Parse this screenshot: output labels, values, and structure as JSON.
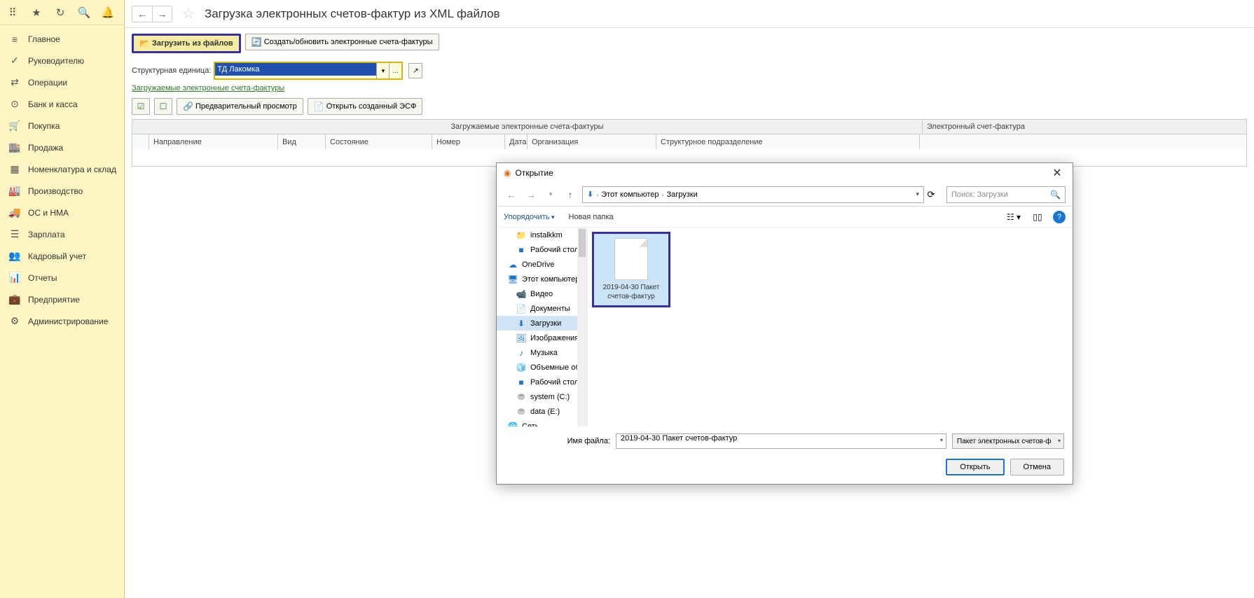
{
  "sidebar": {
    "items": [
      {
        "icon": "≡",
        "label": "Главное"
      },
      {
        "icon": "✓",
        "label": "Руководителю"
      },
      {
        "icon": "⇄",
        "label": "Операции"
      },
      {
        "icon": "⊙",
        "label": "Банк и касса"
      },
      {
        "icon": "🛒",
        "label": "Покупка"
      },
      {
        "icon": "🏬",
        "label": "Продажа"
      },
      {
        "icon": "▦",
        "label": "Номенклатура и склад"
      },
      {
        "icon": "🏭",
        "label": "Производство"
      },
      {
        "icon": "🚚",
        "label": "ОС и НМА"
      },
      {
        "icon": "☰",
        "label": "Зарплата"
      },
      {
        "icon": "👥",
        "label": "Кадровый учет"
      },
      {
        "icon": "📊",
        "label": "Отчеты"
      },
      {
        "icon": "💼",
        "label": "Предприятие"
      },
      {
        "icon": "⚙",
        "label": "Администрирование"
      }
    ]
  },
  "header": {
    "title": "Загрузка электронных счетов-фактур из XML файлов"
  },
  "toolbar": {
    "load": "Загрузить из файлов",
    "create": "Создать/обновить электронные счета-фактуры"
  },
  "struct": {
    "label": "Структурная единица:",
    "value": "ТД Лакомка"
  },
  "section": {
    "title": "Загружаемые электронные счета-фактуры",
    "preview": "Предварительный просмотр",
    "open_esf": "Открыть созданный ЭСФ"
  },
  "table": {
    "group1": "Загружаемые электронные счета-фактуры",
    "group2": "Электронный счет-фактура",
    "cols": {
      "direction": "Направление",
      "type": "Вид",
      "state": "Состояние",
      "number": "Номер",
      "date": "Дата",
      "org": "Организация",
      "subdiv": "Структурное подразделение"
    }
  },
  "dialog": {
    "title": "Открытие",
    "path": {
      "root": "Этот компьютер",
      "folder": "Загрузки"
    },
    "search_placeholder": "Поиск: Загрузки",
    "organize": "Упорядочить",
    "new_folder": "Новая папка",
    "tree": [
      {
        "icon": "📁",
        "cls": "folder",
        "label": "instalkkm",
        "indent": true
      },
      {
        "icon": "■",
        "cls": "blue-folder",
        "label": "Рабочий стол",
        "indent": true
      },
      {
        "icon": "☁",
        "cls": "cloud",
        "label": "OneDrive",
        "indent": false
      },
      {
        "icon": "🖥",
        "cls": "pc",
        "label": "Этот компьютер",
        "indent": false
      },
      {
        "icon": "📹",
        "cls": "blue-folder",
        "label": "Видео",
        "indent": true
      },
      {
        "icon": "📄",
        "cls": "blue-folder",
        "label": "Документы",
        "indent": true
      },
      {
        "icon": "⬇",
        "cls": "blue-folder",
        "label": "Загрузки",
        "indent": true,
        "active": true
      },
      {
        "icon": "🖼",
        "cls": "blue-folder",
        "label": "Изображения",
        "indent": true
      },
      {
        "icon": "♪",
        "cls": "blue-folder",
        "label": "Музыка",
        "indent": true
      },
      {
        "icon": "🧊",
        "cls": "blue-folder",
        "label": "Объемные объ",
        "indent": true
      },
      {
        "icon": "■",
        "cls": "blue-folder",
        "label": "Рабочий стол",
        "indent": true
      },
      {
        "icon": "⛃",
        "cls": "drive",
        "label": "system (C:)",
        "indent": true
      },
      {
        "icon": "⛃",
        "cls": "drive",
        "label": "data (E:)",
        "indent": true
      },
      {
        "icon": "🌐",
        "cls": "pc",
        "label": "Сеть",
        "indent": false
      }
    ],
    "file": {
      "name": "2019-04-30 Пакет счетов-фактур"
    },
    "footer": {
      "label": "Имя файла:",
      "value": "2019-04-30 Пакет счетов-фактур",
      "filter": "Пакет электронных счетов-ф",
      "open": "Открыть",
      "cancel": "Отмена"
    }
  }
}
